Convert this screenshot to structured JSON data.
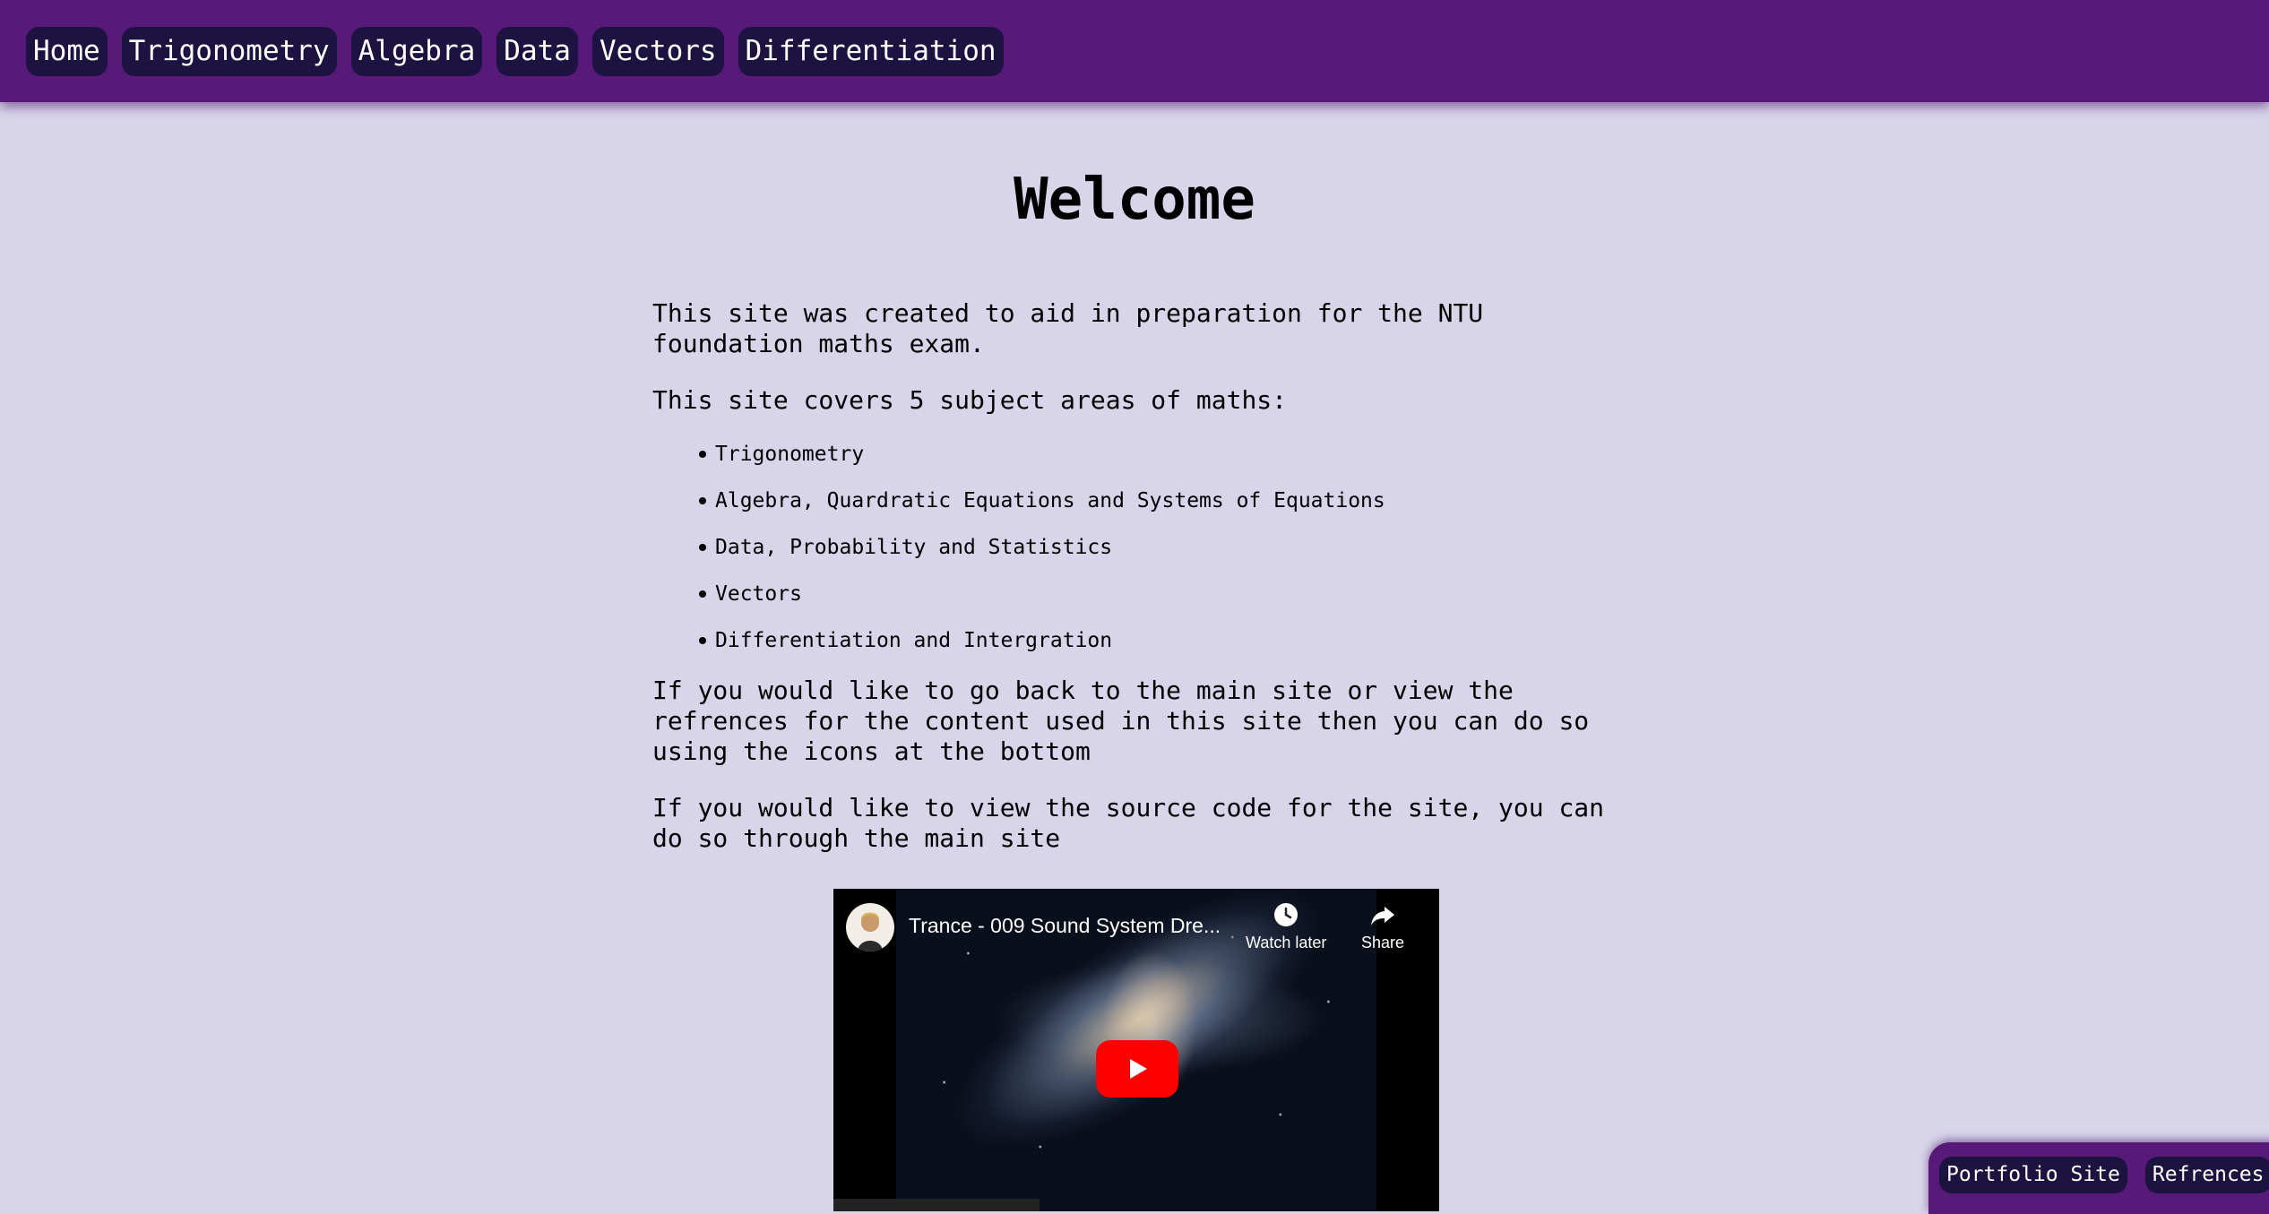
{
  "nav": {
    "items": [
      {
        "label": "Home"
      },
      {
        "label": "Trigonometry"
      },
      {
        "label": "Algebra"
      },
      {
        "label": "Data"
      },
      {
        "label": "Vectors"
      },
      {
        "label": "Differentiation"
      }
    ]
  },
  "main": {
    "title": "Welcome",
    "intro": "This site was created to aid in preparation for the NTU foundation maths exam.",
    "covers": "This site covers 5 subject areas of maths:",
    "subjects": [
      "Trigonometry",
      "Algebra, Quardratic Equations and Systems of Equations",
      "Data, Probability and Statistics",
      "Vectors",
      "Differentiation and Intergration"
    ],
    "back_note": "If you would like to go back to the main site or view the refrences for the content used in this site then you can do so using the icons at the bottom",
    "source_note": "If you would like to view the source code for the site, you can do so through the main site"
  },
  "video": {
    "title": "Trance - 009 Sound System Dre...",
    "watch_later": "Watch later",
    "share": "Share",
    "icons": [
      "channel-avatar",
      "clock-icon",
      "share-icon",
      "play-icon"
    ],
    "play_color": "#ff0000"
  },
  "footer": {
    "portfolio": "Portfolio Site",
    "references": "Refrences"
  },
  "colors": {
    "nav_bg": "#581a78",
    "button_bg": "#1c1340",
    "page_bg": "#d8d4ea"
  }
}
